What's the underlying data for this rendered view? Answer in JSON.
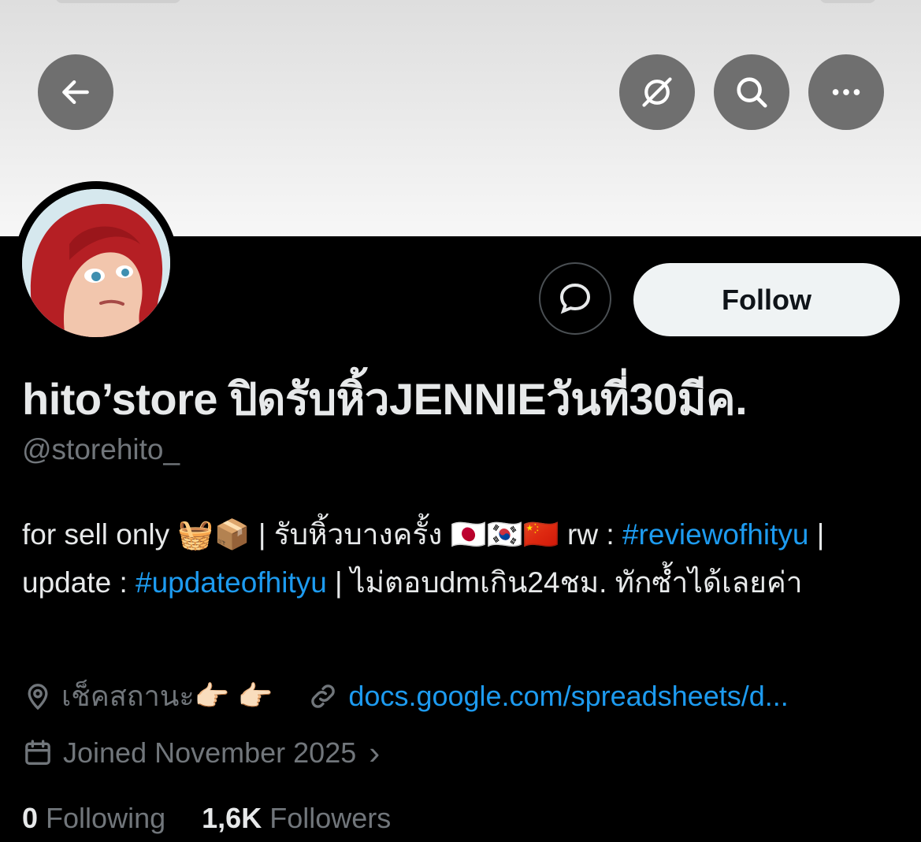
{
  "header": {
    "back_icon": "arrow-left-icon",
    "action_icons": [
      "grok-icon",
      "search-icon",
      "more-icon"
    ]
  },
  "profile": {
    "avatar": "avatar",
    "message_icon": "message-icon",
    "follow_label": "Follow",
    "display_name": "hito’store ปิดรับหิ้วJENNIEวันที่30มีค.",
    "handle": "@storehito_"
  },
  "bio": {
    "part1": "for sell only 🧺📦 | รับหิ้วบางครั้ง 🇯🇵🇰🇷🇨🇳 rw : ",
    "tag1": "#reviewofhityu",
    "part2": " | update : ",
    "tag2": "#updateofhityu",
    "part3": " | ไม่ตอบdmเกิน24ชม. ทักซ้ำได้เลยค่า"
  },
  "meta": {
    "location": "เช็คสถานะ👉🏻 👉🏻",
    "link": "docs.google.com/spreadsheets/d...",
    "joined": "Joined November 2025",
    "joined_chevron": "›"
  },
  "stats": {
    "following_count": "0",
    "following_label": "Following",
    "followers_count": "1,6K",
    "followers_label": "Followers"
  },
  "colors": {
    "link_blue": "#1d9bf0",
    "muted": "#71767b",
    "text": "#e7e9ea",
    "follow_bg": "#eff3f4"
  }
}
